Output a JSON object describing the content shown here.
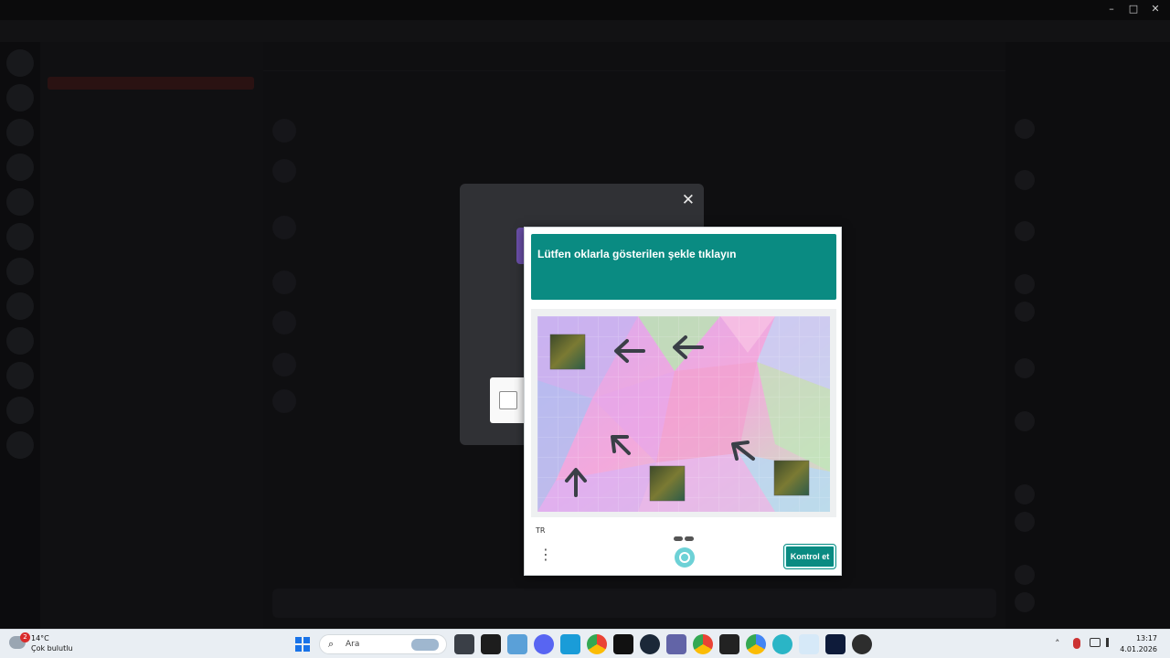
{
  "window": {
    "minimize": "–",
    "maximize": "□",
    "close": "✕"
  },
  "captcha": {
    "prompt": "Lütfen oklarla gösterilen şekle tıklayın",
    "language": "TR",
    "verify_label": "Kontrol et",
    "menu_glyph": "⋮",
    "accent": "#0a8b82",
    "page_count": 2,
    "current_page": 2,
    "icons": [
      "menu-dots-icon",
      "hcaptcha-logo-icon"
    ]
  },
  "modal": {
    "close_glyph": "✕",
    "icons": [
      "close-icon",
      "checkbox-icon"
    ]
  },
  "taskbar": {
    "weather": {
      "temperature": "14°C",
      "condition": "Çok bulutlu",
      "badge": "2"
    },
    "search_placeholder": "Ara",
    "search_glyph": "⌕",
    "apps": [
      "windows-start",
      "search",
      "file-explorer",
      "terminal",
      "folder",
      "discord",
      "monitor",
      "chrome",
      "tiktok",
      "steam",
      "teams",
      "chrome-alt",
      "epic",
      "chrome-beta",
      "edge",
      "snipping",
      "teamviewer",
      "obs"
    ],
    "clock": {
      "time": "13:17",
      "date": "4.01.2026"
    },
    "tray": {
      "chevron": "˄"
    }
  },
  "colors": {
    "accent_teal": "#0a8b82",
    "modal_bg": "#303135",
    "taskbar_bg": "#e9eef3"
  }
}
